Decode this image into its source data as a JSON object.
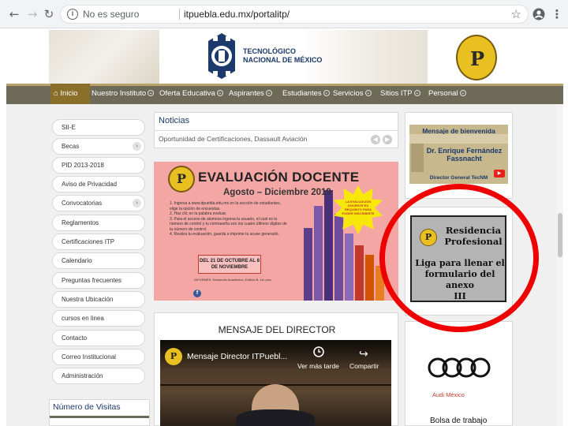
{
  "browser": {
    "back": "←",
    "forward": "→",
    "reload": "↻",
    "info_icon": "i",
    "security_text": "No es seguro",
    "url": "itpuebla.edu.mx/portalitp/",
    "star_icon": "star-icon",
    "profile_icon": "profile-icon",
    "menu_icon": "⋮"
  },
  "header": {
    "institution_line1": "TECNOLÓGICO",
    "institution_line2": "NACIONAL DE MÉXICO",
    "logo_letter": "P"
  },
  "menu": {
    "items": [
      {
        "label": "Inicio"
      },
      {
        "label": "Nuestro Instituto"
      },
      {
        "label": "Oferta Educativa"
      },
      {
        "label": "Aspirantes"
      },
      {
        "label": "Estudiantes"
      },
      {
        "label": "Servicios"
      },
      {
        "label": "Sitios ITP"
      },
      {
        "label": "Personal"
      }
    ]
  },
  "sidebar": {
    "items": [
      {
        "label": "SII-E"
      },
      {
        "label": "Becas"
      },
      {
        "label": "PID 2013-2018"
      },
      {
        "label": "Aviso de Privacidad"
      },
      {
        "label": "Convocatorias"
      },
      {
        "label": "Reglamentos"
      },
      {
        "label": "Certificaciones ITP"
      },
      {
        "label": "Calendario"
      },
      {
        "label": "Preguntas frecuentes"
      },
      {
        "label": "Nuestra Ubicación"
      },
      {
        "label": "cursos en linea"
      },
      {
        "label": "Contacto"
      },
      {
        "label": "Correo Institucional"
      },
      {
        "label": "Administración"
      }
    ],
    "visits_title": "Número de Visitas"
  },
  "news": {
    "title": "Noticias",
    "headline": "Oportunidad de Certificaciones, Dassault Aviación",
    "prev": "◀",
    "next": "▶"
  },
  "evaluation": {
    "title": "EVALUACIÓN DOCENTE",
    "period": "Agosto – Diciembre 2019",
    "burst_text": "LA EVALUACIÓN DOCENTE ES REQUISITO PARA PODER INSCRIBIRTE",
    "steps": [
      "1. Ingresa a www.itpuebla.edu.mx en la sección de estudiantes, elige la opción de encuestas.",
      "2. Haz clic en la palabra evaluar.",
      "3. Para el acceso de alumnos ingresa tu usuario, el cual es tu número de control y tu contraseña son los cuatro últimos dígitos de tu número de control.",
      "4. Realiza tu evaluación, guarda e imprime tu acuse generado."
    ],
    "deadline": "DEL 21 DE OCTUBRE AL 8 DE NOVIEMBRE",
    "info": "INFORMES: Desarrollo Académico, Edificio B, 1er piso",
    "fb_icon": "f"
  },
  "director": {
    "title": "MENSAJE DEL DIRECTOR",
    "video_title": "Mensaje Director ITPuebl...",
    "watch_later": "Ver más tarde",
    "share": "Compartir",
    "clock_icon": "clock-icon",
    "share_icon": "share-icon"
  },
  "welcome": {
    "heading": "Mensaje de bienvenida",
    "name_line1": "Dr. Enrique Fernández",
    "name_line2": "Fassnacht",
    "subtitle": "Director General TecNM",
    "yt_icon": "▶"
  },
  "residencia": {
    "title_line1": "Residencia",
    "title_line2": "Profesional",
    "link_line1": "Liga para llenar el",
    "link_line2": "formulario del anexo",
    "link_line3": "III"
  },
  "audi": {
    "brand": "Audi México",
    "caption": "Bolsa de trabajo"
  },
  "colors": {
    "menu_bg": "#6e6a58",
    "accent_gold": "#b9a16a",
    "brand_blue": "#1b396a",
    "annotation_red": "#ee0000",
    "eval_pink": "#f4a6a4"
  }
}
